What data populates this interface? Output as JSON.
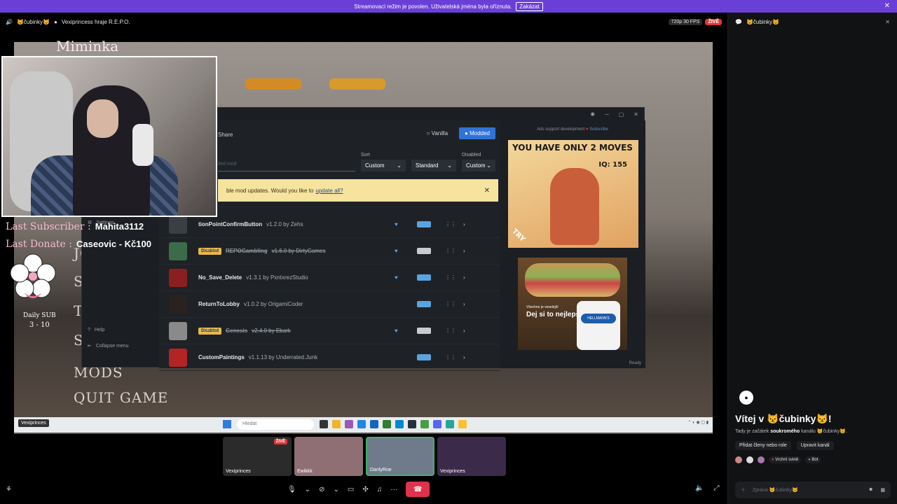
{
  "notice": {
    "text": "Streamovací režim je povolen. Uživatelská jména byla oříznuta.",
    "button": "Zakázat",
    "close": "✕"
  },
  "topbar": {
    "channel": "😾čubinky😾",
    "stream_title": "Vexiprincess hraje R.E.P.O.",
    "quality": "720p 30 FPS",
    "live": "ŽIVĚ"
  },
  "overlay": {
    "title": "Miminka",
    "last_sub_label": "Last Subscriber :",
    "last_sub_value": "Mahita3112",
    "last_donate_label": "Last Donate :",
    "last_donate_value": "Caseovic - Kč100",
    "daily_label": "Daily SUB",
    "daily_count": "3 - 10"
  },
  "game_menu": [
    "JO",
    "SI",
    "TU",
    "SE",
    "MODS",
    "QUIT GAME"
  ],
  "app": {
    "share": "Share",
    "mode_vanilla": "Vanilla",
    "mode_modded": "Modded",
    "search_placeholder": "lled mod",
    "sort_label": "Sort",
    "sort_value": "Custom",
    "sort2_value": "Standard",
    "disabled_label": "Disabled",
    "disabled_value": "Custom",
    "update_text": "ble mod updates. Would you like to",
    "update_link": "update all?",
    "side_settings": "Settings",
    "side_help": "Help",
    "side_collapse": "Collapse menu",
    "ready": "Ready",
    "ads_header": "Ads support development",
    "ads_subscribe": "Subscribe",
    "mods": [
      {
        "name": "tionPointConfirmButton",
        "ver": "v1.2.0 by Zehs",
        "disabled": false,
        "fav": true,
        "on": true,
        "thumb": "#3a3f44"
      },
      {
        "name": "REPOGambling",
        "ver": "v1.6.0 by DirtyGames",
        "disabled": true,
        "fav": true,
        "on": false,
        "thumb": "#3c6b4a"
      },
      {
        "name": "No_Save_Delete",
        "ver": "v1.3.1 by PxntxrezStudio",
        "disabled": false,
        "fav": true,
        "on": true,
        "thumb": "#8b1f1f"
      },
      {
        "name": "ReturnToLobby",
        "ver": "v1.0.2 by OrigamiCoder",
        "disabled": false,
        "fav": false,
        "on": true,
        "thumb": "#2a2220"
      },
      {
        "name": "Genesis",
        "ver": "v2.4.0 by Ebark",
        "disabled": true,
        "fav": true,
        "on": false,
        "thumb": "#8a8a8a"
      },
      {
        "name": "CustomPaintings",
        "ver": "v1.1.13 by Underrated.Junk",
        "disabled": false,
        "fav": false,
        "on": true,
        "thumb": "#b32424"
      }
    ],
    "disabled_badge": "Disabled"
  },
  "ads": {
    "ad1_title": "YOU HAVE ONLY 2 MOVES",
    "ad1_iq": "IQ: 155",
    "ad1_try": "TRY",
    "ad2_small": "Všechno je veselejší",
    "ad2_text": "Dej si to nejlepší",
    "ad2_brand": "HELLMANN'S"
  },
  "taskbar": {
    "tag": "Vexiprinces",
    "search": "Hledat"
  },
  "tiles": [
    {
      "label": "Vexiprinces",
      "live": "ŽIVĚ",
      "bg": "#2b2b2b"
    },
    {
      "label": "Ewikkk",
      "bg": "#8f6f74"
    },
    {
      "label": "DanlyRoe",
      "bg": "#6f7a8a"
    },
    {
      "label": "Vexiprinces",
      "bg": "#3b2a4a"
    }
  ],
  "chat": {
    "channel": "😾čubinky😾",
    "welcome": "Vítej v 😾čubinky😾!",
    "desc_pre": "Tady je začátek",
    "desc_bold": "soukromého",
    "desc_post": "kanálu 😾čubinky😾.",
    "add_members": "Přidat členy nebo role",
    "edit_channel": "Upravit kanál",
    "role1": "Vrchní svině",
    "role2": "Bot",
    "input_placeholder": "Zpráva 😾čubinky😾"
  }
}
